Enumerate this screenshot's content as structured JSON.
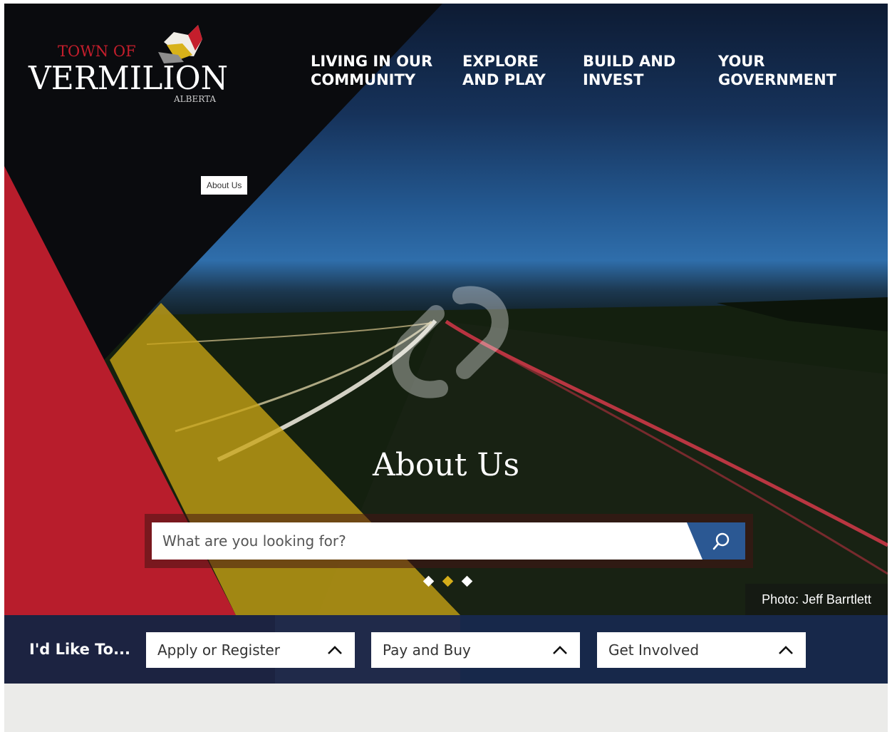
{
  "header": {
    "logo": {
      "line1": "TOWN OF",
      "line2": "VERMILION",
      "line3": "ALBERTA"
    },
    "nav": [
      {
        "line1": "LIVING IN OUR",
        "line2": "COMMUNITY"
      },
      {
        "line1": "EXPLORE",
        "line2": "AND PLAY"
      },
      {
        "line1": "BUILD AND",
        "line2": "INVEST"
      },
      {
        "line1": "YOUR",
        "line2": "GOVERNMENT"
      }
    ]
  },
  "breadcrumb": {
    "current": "About Us"
  },
  "hero": {
    "title": "About Us",
    "photo_credit": "Photo: Jeff Barrtlett",
    "slides": {
      "count": 3,
      "active": 1
    }
  },
  "search": {
    "placeholder": "What are you looking for?",
    "value": "",
    "button_icon": "search-icon"
  },
  "like_to": {
    "label": "I'd Like To...",
    "dropdowns": [
      {
        "label": "Apply or Register",
        "icon": "chevron-up-icon"
      },
      {
        "label": "Pay and Buy",
        "icon": "chevron-up-icon"
      },
      {
        "label": "Get Involved",
        "icon": "chevron-up-icon"
      }
    ]
  },
  "colors": {
    "red": "#b81d2c",
    "gold": "#c9a414",
    "navy": "#17284a",
    "search_blue": "#2b5893",
    "black": "#0a0b0e"
  }
}
